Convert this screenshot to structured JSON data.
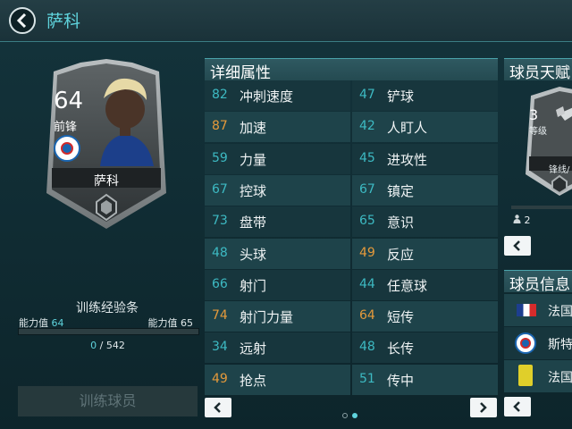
{
  "header": {
    "title": "萨科"
  },
  "card": {
    "rating": "64",
    "position": "前锋",
    "name": "萨科"
  },
  "training": {
    "title": "训练经验条",
    "left_label": "能力值",
    "left_value": "64",
    "right_label": "能力值",
    "right_value": "65",
    "current": "0",
    "separator": "/",
    "total": "542",
    "progress": 0,
    "button_label": "训练球员"
  },
  "attributes": {
    "title": "详细属性",
    "rows": [
      {
        "left": {
          "value": "82",
          "label": "冲刺速度",
          "color": "teal"
        },
        "right": {
          "value": "47",
          "label": "铲球",
          "color": "teal"
        }
      },
      {
        "left": {
          "value": "87",
          "label": "加速",
          "color": "orange"
        },
        "right": {
          "value": "42",
          "label": "人盯人",
          "color": "teal"
        }
      },
      {
        "left": {
          "value": "59",
          "label": "力量",
          "color": "teal"
        },
        "right": {
          "value": "45",
          "label": "进攻性",
          "color": "teal"
        }
      },
      {
        "left": {
          "value": "67",
          "label": "控球",
          "color": "teal"
        },
        "right": {
          "value": "67",
          "label": "镇定",
          "color": "teal"
        }
      },
      {
        "left": {
          "value": "73",
          "label": "盘带",
          "color": "teal"
        },
        "right": {
          "value": "65",
          "label": "意识",
          "color": "teal"
        }
      },
      {
        "left": {
          "value": "48",
          "label": "头球",
          "color": "teal"
        },
        "right": {
          "value": "49",
          "label": "反应",
          "color": "orange"
        }
      },
      {
        "left": {
          "value": "66",
          "label": "射门",
          "color": "teal"
        },
        "right": {
          "value": "44",
          "label": "任意球",
          "color": "teal"
        }
      },
      {
        "left": {
          "value": "74",
          "label": "射门力量",
          "color": "orange"
        },
        "right": {
          "value": "64",
          "label": "短传",
          "color": "orange"
        }
      },
      {
        "left": {
          "value": "34",
          "label": "远射",
          "color": "teal"
        },
        "right": {
          "value": "48",
          "label": "长传",
          "color": "teal"
        }
      },
      {
        "left": {
          "value": "49",
          "label": "抢点",
          "color": "orange"
        },
        "right": {
          "value": "51",
          "label": "传中",
          "color": "teal"
        }
      }
    ],
    "page_count": 2,
    "current_page": 2
  },
  "talent": {
    "title": "球员天赋",
    "level": "3",
    "level_label": "等级",
    "subtitle": "锋线/",
    "count": "2"
  },
  "info": {
    "title": "球员信息",
    "nationality": "法国",
    "club": "斯特",
    "league": "法国"
  },
  "colors": {
    "accent": "#5fd3dc",
    "orange": "#e59a3b",
    "background": "#0f2a30"
  },
  "icons": {
    "back": "chevron-left-icon",
    "prev": "chevron-left-icon",
    "next": "chevron-right-icon"
  }
}
